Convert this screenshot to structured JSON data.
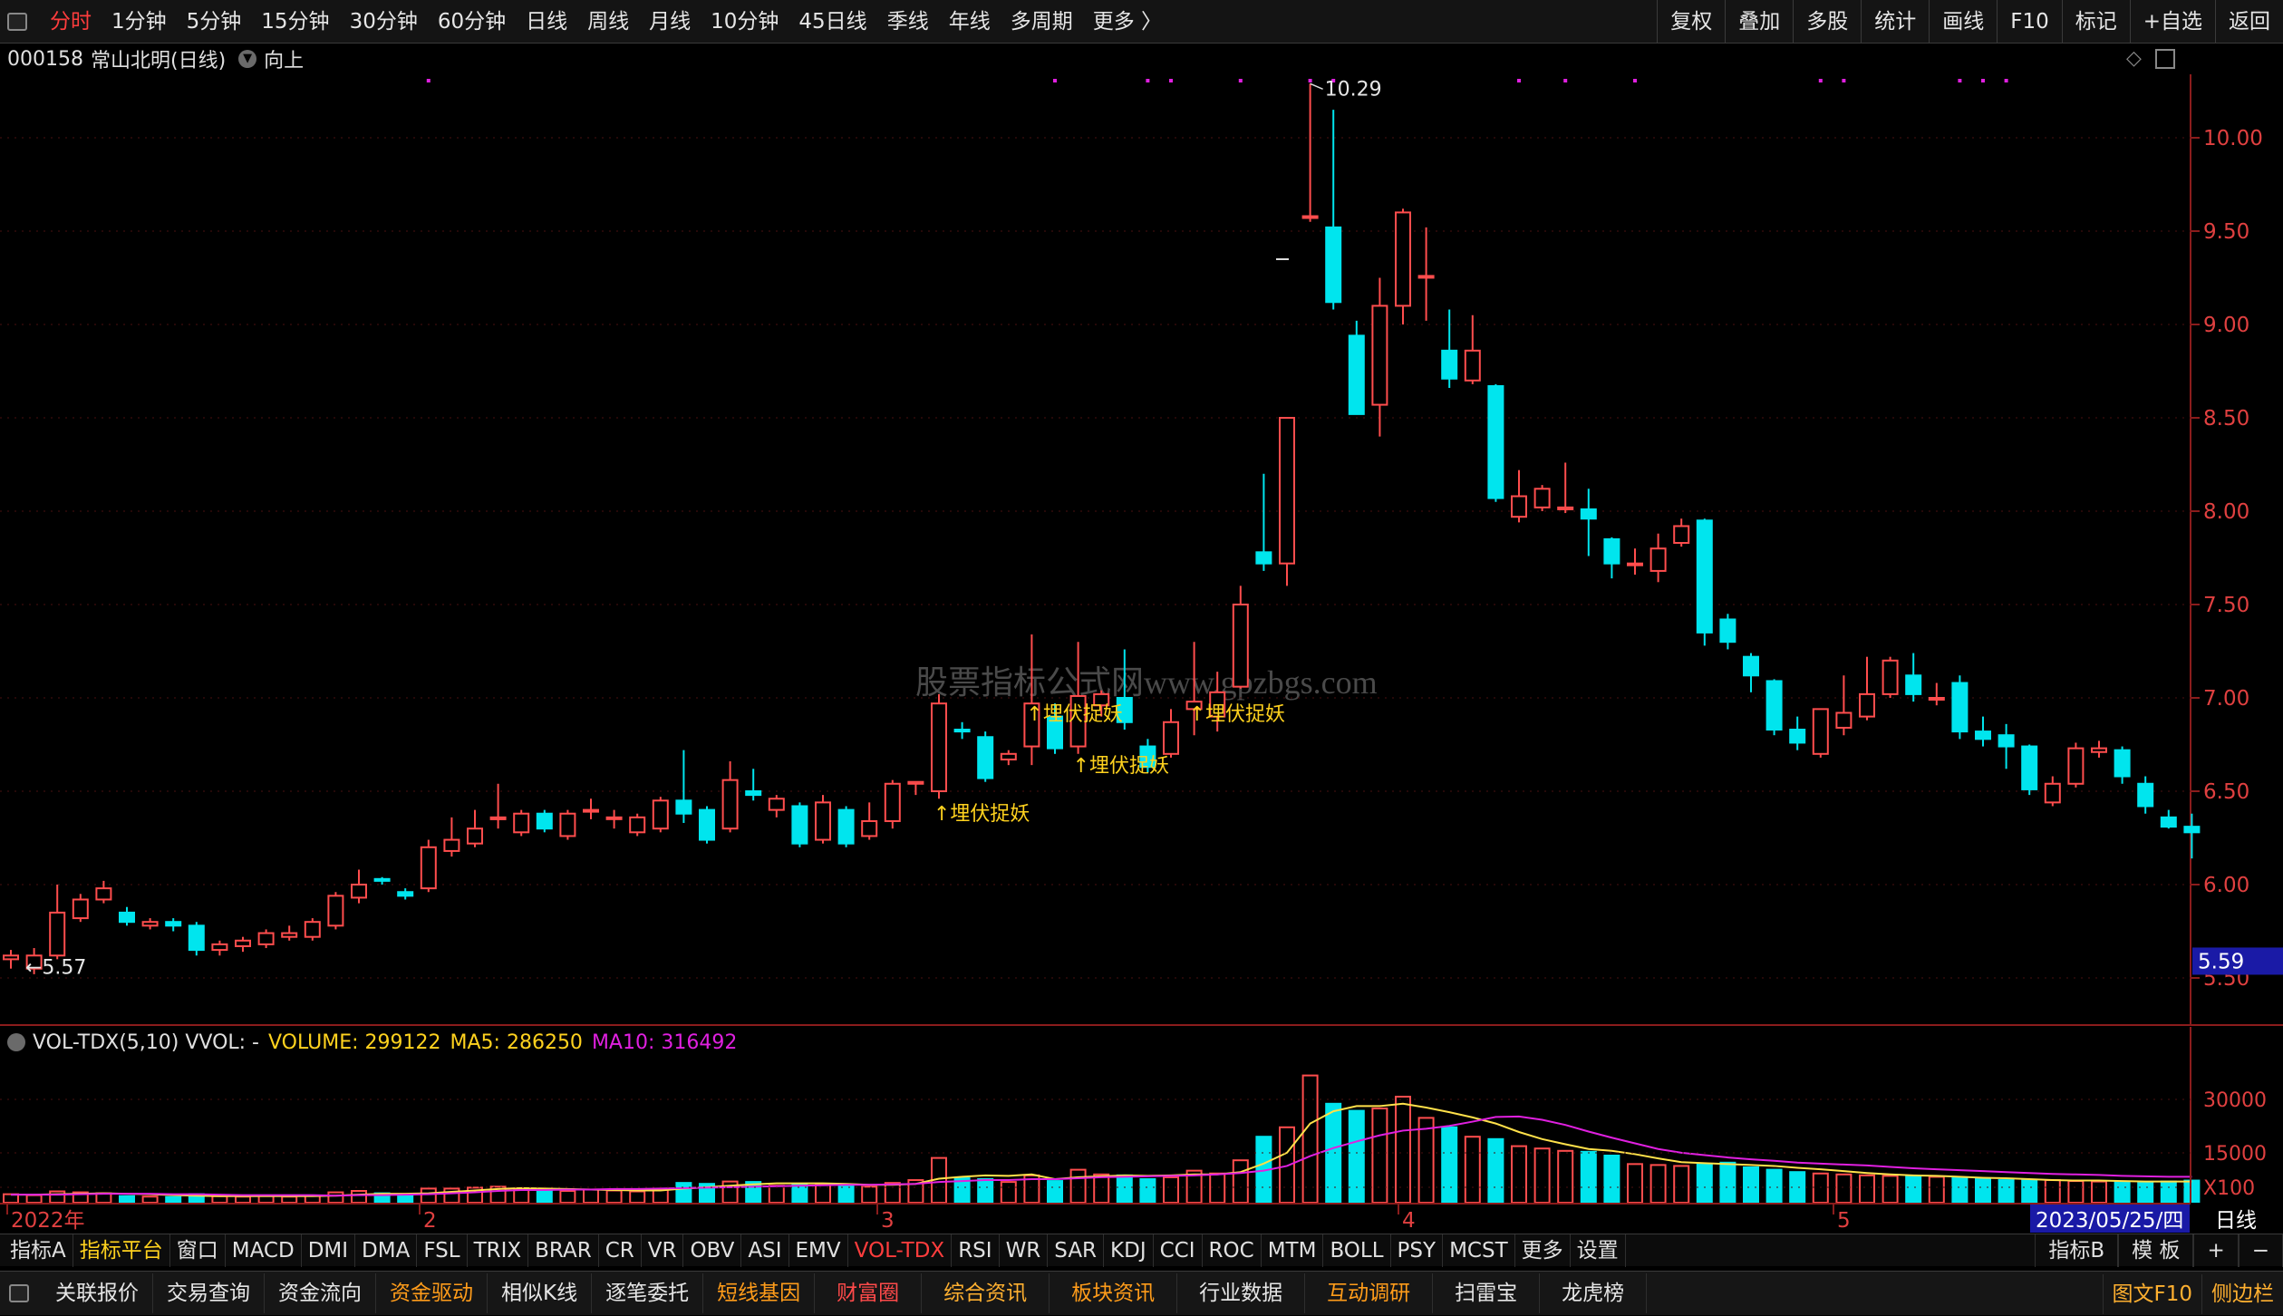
{
  "top_bar": {
    "periods": [
      "分时",
      "1分钟",
      "5分钟",
      "15分钟",
      "30分钟",
      "60分钟",
      "日线",
      "周线",
      "月线",
      "10分钟",
      "45日线",
      "季线",
      "年线",
      "多周期",
      "更多 〉"
    ],
    "active_period": "分时",
    "right_buttons": [
      "复权",
      "叠加",
      "多股",
      "统计",
      "画线",
      "F10",
      "标记",
      "+自选",
      "返回"
    ]
  },
  "info": {
    "code": "000158",
    "name_period": "常山北明(日线)",
    "direction": "向上"
  },
  "watermark": "股票指标公式网www.gpzbgs.com",
  "price_axis": {
    "ticks": [
      "10.00",
      "9.50",
      "9.00",
      "8.50",
      "8.00",
      "7.50",
      "7.00",
      "6.50",
      "6.00",
      "5.50"
    ],
    "current": "5.59"
  },
  "annotations": {
    "high_label": "10.29",
    "low_label": "5.57",
    "signal_text": "↑埋伏捉妖"
  },
  "volume_panel": {
    "title": "VOL-TDX(5,10) VVOL: -",
    "volume_text": "VOLUME: 299122",
    "ma5_text": "MA5: 286250",
    "ma10_text": "MA10: 316492",
    "axis": [
      "30000",
      "15000",
      "X100"
    ]
  },
  "date_axis": {
    "labels": [
      "2022年",
      "2",
      "3",
      "4",
      "5"
    ],
    "current_date": "2023/05/25/四",
    "period_tab": "日线"
  },
  "indicator_bar": {
    "items": [
      "指标A",
      "指标平台",
      "窗口",
      "MACD",
      "DMI",
      "DMA",
      "FSL",
      "TRIX",
      "BRAR",
      "CR",
      "VR",
      "OBV",
      "ASI",
      "EMV",
      "VOL-TDX",
      "RSI",
      "WR",
      "SAR",
      "KDJ",
      "CCI",
      "ROC",
      "MTM",
      "BOLL",
      "PSY",
      "MCST",
      "更多",
      "设置"
    ],
    "right": [
      "指标B",
      "模 板",
      "+",
      "−"
    ]
  },
  "bottom_bar": {
    "items": [
      "关联报价",
      "交易查询",
      "资金流向",
      "资金驱动",
      "相似K线",
      "逐笔委托",
      "短线基因",
      "财富圈",
      "综合资讯",
      "板块资讯",
      "行业数据",
      "互动调研",
      "扫雷宝",
      "龙虎榜"
    ],
    "right": [
      "图文F10",
      "侧边栏"
    ]
  },
  "chart_data": {
    "type": "candlestick",
    "y_range": [
      5.3,
      10.4
    ],
    "candles": [
      [
        5.6,
        5.62,
        5.55,
        5.65
      ],
      [
        5.55,
        5.62,
        5.52,
        5.66
      ],
      [
        5.62,
        5.85,
        5.6,
        6.0
      ],
      [
        5.82,
        5.92,
        5.8,
        5.95
      ],
      [
        5.92,
        5.98,
        5.9,
        6.02
      ],
      [
        5.85,
        5.8,
        5.78,
        5.88
      ],
      [
        5.78,
        5.8,
        5.76,
        5.82
      ],
      [
        5.8,
        5.78,
        5.75,
        5.82
      ],
      [
        5.78,
        5.65,
        5.62,
        5.8
      ],
      [
        5.65,
        5.68,
        5.62,
        5.7
      ],
      [
        5.67,
        5.7,
        5.64,
        5.72
      ],
      [
        5.68,
        5.74,
        5.66,
        5.76
      ],
      [
        5.72,
        5.74,
        5.7,
        5.78
      ],
      [
        5.72,
        5.8,
        5.7,
        5.82
      ],
      [
        5.78,
        5.94,
        5.76,
        5.96
      ],
      [
        5.93,
        6.0,
        5.9,
        6.08
      ],
      [
        6.03,
        6.02,
        6.0,
        6.04
      ],
      [
        5.96,
        5.94,
        5.92,
        5.98
      ],
      [
        5.98,
        6.2,
        5.96,
        6.24
      ],
      [
        6.18,
        6.24,
        6.15,
        6.36
      ],
      [
        6.22,
        6.3,
        6.2,
        6.4
      ],
      [
        6.35,
        6.36,
        6.3,
        6.54
      ],
      [
        6.28,
        6.38,
        6.26,
        6.4
      ],
      [
        6.38,
        6.3,
        6.28,
        6.4
      ],
      [
        6.26,
        6.38,
        6.24,
        6.4
      ],
      [
        6.4,
        6.4,
        6.35,
        6.46
      ],
      [
        6.36,
        6.36,
        6.3,
        6.4
      ],
      [
        6.28,
        6.36,
        6.26,
        6.38
      ],
      [
        6.3,
        6.45,
        6.28,
        6.47
      ],
      [
        6.45,
        6.38,
        6.33,
        6.72
      ],
      [
        6.4,
        6.24,
        6.22,
        6.42
      ],
      [
        6.3,
        6.56,
        6.28,
        6.66
      ],
      [
        6.5,
        6.48,
        6.45,
        6.62
      ],
      [
        6.4,
        6.46,
        6.36,
        6.48
      ],
      [
        6.42,
        6.22,
        6.2,
        6.44
      ],
      [
        6.24,
        6.44,
        6.22,
        6.48
      ],
      [
        6.4,
        6.22,
        6.2,
        6.42
      ],
      [
        6.26,
        6.34,
        6.24,
        6.44
      ],
      [
        6.34,
        6.54,
        6.3,
        6.56
      ],
      [
        6.54,
        6.55,
        6.48,
        6.55
      ],
      [
        6.5,
        6.97,
        6.46,
        7.02
      ],
      [
        6.83,
        6.82,
        6.78,
        6.87
      ],
      [
        6.79,
        6.57,
        6.55,
        6.82
      ],
      [
        6.67,
        6.7,
        6.64,
        6.72
      ],
      [
        6.74,
        6.97,
        6.64,
        7.34
      ],
      [
        6.9,
        6.73,
        6.7,
        6.97
      ],
      [
        6.74,
        7.01,
        6.7,
        7.3
      ],
      [
        6.96,
        7.02,
        6.9,
        7.04
      ],
      [
        7.0,
        6.87,
        6.83,
        7.26
      ],
      [
        6.74,
        6.63,
        6.6,
        6.78
      ],
      [
        6.7,
        6.87,
        6.68,
        6.94
      ],
      [
        6.94,
        6.98,
        6.8,
        7.3
      ],
      [
        6.9,
        7.03,
        6.82,
        7.14
      ],
      [
        7.06,
        7.5,
        7.05,
        7.6
      ],
      [
        7.78,
        7.72,
        7.68,
        8.2
      ],
      [
        7.72,
        8.5,
        7.6,
        8.5
      ],
      [
        9.58,
        9.58,
        9.55,
        10.29
      ],
      [
        9.52,
        9.12,
        9.08,
        10.15
      ],
      [
        8.94,
        8.52,
        8.52,
        9.02
      ],
      [
        8.57,
        9.1,
        8.4,
        9.25
      ],
      [
        9.1,
        9.6,
        9.0,
        9.62
      ],
      [
        9.26,
        9.26,
        9.02,
        9.52
      ],
      [
        8.86,
        8.71,
        8.66,
        9.08
      ],
      [
        8.7,
        8.86,
        8.68,
        9.05
      ],
      [
        8.67,
        8.07,
        8.05,
        8.68
      ],
      [
        7.97,
        8.08,
        7.94,
        8.22
      ],
      [
        8.02,
        8.12,
        8.0,
        8.14
      ],
      [
        8.01,
        8.02,
        7.99,
        8.26
      ],
      [
        8.01,
        7.96,
        7.76,
        8.12
      ],
      [
        7.85,
        7.72,
        7.64,
        7.86
      ],
      [
        7.72,
        7.72,
        7.66,
        7.8
      ],
      [
        7.68,
        7.8,
        7.62,
        7.88
      ],
      [
        7.83,
        7.92,
        7.81,
        7.96
      ],
      [
        7.95,
        7.35,
        7.28,
        7.96
      ],
      [
        7.42,
        7.3,
        7.26,
        7.45
      ],
      [
        7.22,
        7.12,
        7.03,
        7.24
      ],
      [
        7.09,
        6.83,
        6.8,
        7.1
      ],
      [
        6.83,
        6.76,
        6.72,
        6.9
      ],
      [
        6.7,
        6.94,
        6.68,
        6.94
      ],
      [
        6.84,
        6.92,
        6.8,
        7.12
      ],
      [
        6.9,
        7.02,
        6.88,
        7.22
      ],
      [
        7.02,
        7.2,
        7.0,
        7.22
      ],
      [
        7.12,
        7.02,
        6.98,
        7.24
      ],
      [
        7.0,
        7.0,
        6.96,
        7.08
      ],
      [
        7.08,
        6.82,
        6.78,
        7.12
      ],
      [
        6.82,
        6.78,
        6.74,
        6.9
      ],
      [
        6.8,
        6.74,
        6.62,
        6.86
      ],
      [
        6.74,
        6.51,
        6.48,
        6.75
      ],
      [
        6.44,
        6.54,
        6.42,
        6.58
      ],
      [
        6.54,
        6.73,
        6.52,
        6.76
      ],
      [
        6.71,
        6.73,
        6.68,
        6.77
      ],
      [
        6.72,
        6.58,
        6.54,
        6.74
      ],
      [
        6.54,
        6.42,
        6.38,
        6.58
      ],
      [
        6.36,
        6.31,
        6.3,
        6.4
      ],
      [
        6.31,
        6.28,
        6.14,
        6.38
      ]
    ],
    "volume": [
      18,
      16,
      24,
      22,
      20,
      14,
      13,
      12,
      18,
      14,
      13,
      15,
      13,
      15,
      22,
      25,
      20,
      16,
      30,
      30,
      32,
      34,
      28,
      26,
      25,
      28,
      26,
      24,
      28,
      42,
      40,
      45,
      44,
      36,
      38,
      40,
      36,
      34,
      42,
      48,
      95,
      52,
      50,
      44,
      58,
      46,
      70,
      60,
      58,
      50,
      54,
      68,
      62,
      90,
      140,
      160,
      270,
      210,
      195,
      200,
      225,
      180,
      160,
      140,
      135,
      120,
      115,
      110,
      108,
      100,
      82,
      80,
      78,
      82,
      85,
      75,
      70,
      65,
      62,
      60,
      58,
      57,
      55,
      55,
      52,
      50,
      48,
      47,
      48,
      46,
      45,
      44,
      44,
      45,
      47
    ],
    "ma5": [
      17,
      17,
      18,
      19,
      20,
      19,
      18,
      16,
      15,
      14,
      14,
      14,
      14,
      14,
      15,
      17,
      19,
      19,
      20,
      23,
      26,
      29,
      31,
      30,
      29,
      28,
      27,
      26,
      26,
      30,
      33,
      36,
      39,
      41,
      41,
      41,
      40,
      38,
      38,
      40,
      51,
      55,
      58,
      57,
      60,
      50,
      54,
      56,
      58,
      57,
      58,
      60,
      60,
      65,
      83,
      106,
      168,
      194,
      205,
      205,
      210,
      202,
      192,
      181,
      168,
      150,
      135,
      124,
      114,
      110,
      103,
      94,
      86,
      84,
      82,
      80,
      78,
      74,
      71,
      67,
      63,
      60,
      58,
      57,
      55,
      53,
      52,
      50,
      48,
      47,
      47,
      46,
      45,
      45,
      45
    ],
    "ma10": [
      17,
      17,
      17,
      18,
      19,
      19,
      19,
      18,
      18,
      17,
      16,
      16,
      16,
      16,
      15,
      16,
      16,
      17,
      18,
      20,
      22,
      25,
      27,
      27,
      28,
      28,
      29,
      29,
      30,
      31,
      32,
      33,
      34,
      35,
      36,
      37,
      38,
      38,
      39,
      40,
      44,
      46,
      48,
      48,
      50,
      50,
      52,
      54,
      55,
      56,
      57,
      58,
      60,
      63,
      68,
      78,
      99,
      116,
      130,
      143,
      153,
      157,
      163,
      172,
      182,
      183,
      176,
      165,
      151,
      138,
      126,
      114,
      106,
      101,
      96,
      92,
      89,
      85,
      83,
      81,
      79,
      76,
      73,
      71,
      69,
      67,
      65,
      63,
      61,
      60,
      59,
      57,
      56,
      55,
      55
    ],
    "signals": [
      {
        "index": 40,
        "row": 2
      },
      {
        "index": 44,
        "row": 0
      },
      {
        "index": 46,
        "row": 1
      },
      {
        "index": 51,
        "row": 0
      }
    ]
  }
}
